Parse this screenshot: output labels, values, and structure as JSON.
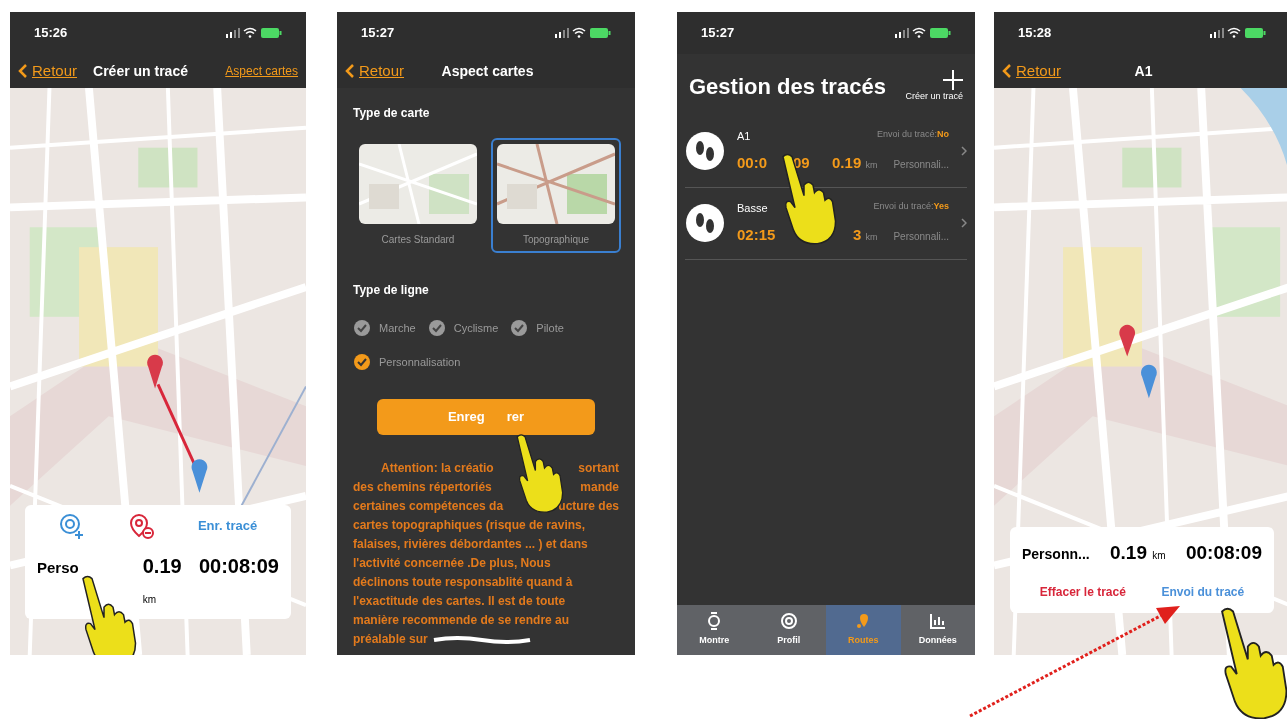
{
  "screens": [
    {
      "kind": "map_create",
      "time": "15:26",
      "nav": {
        "back": "Retour",
        "title": "Créer un tracé",
        "action": "Aspect cartes"
      },
      "panel": {
        "save": "Enr. tracé",
        "name": "Perso",
        "distance": "0.19",
        "unit": "km",
        "duration": "00:08:09"
      }
    },
    {
      "kind": "settings",
      "time": "15:27",
      "nav": {
        "back": "Retour",
        "title": "Aspect cartes"
      },
      "map_type_label": "Type de carte",
      "map_types": [
        {
          "label": "Cartes Standard",
          "selected": false
        },
        {
          "label": "Topographique",
          "selected": true
        }
      ],
      "line_type_label": "Type de ligne",
      "line_types": [
        {
          "label": "Marche",
          "checked": false
        },
        {
          "label": "Cyclisme",
          "checked": false
        },
        {
          "label": "Pilote",
          "checked": false
        },
        {
          "label": "Personnalisation",
          "checked": true
        }
      ],
      "save_button": [
        "Enreg",
        "rer"
      ],
      "warning_lines": [
        [
          "Attention: la créatio",
          "sortant"
        ],
        [
          "des chemins répertoriés",
          "mande"
        ],
        [
          "certaines compétences da",
          "ucture des"
        ],
        [
          "cartes topographiques (risque de ravins,"
        ],
        [
          "falaises, rivières débordantes ... ) et dans"
        ],
        [
          "l'activité concernée .De plus,  Nous"
        ],
        [
          "déclinons toute responsablité quand à"
        ],
        [
          "l'exactitude des cartes. Il est de toute"
        ],
        [
          "manière recommende de se rendre au"
        ],
        [
          "préalable sur"
        ]
      ]
    },
    {
      "kind": "list",
      "time": "15:27",
      "title": "Gestion des tracés",
      "create": "Créer un tracé",
      "routes": [
        {
          "name": "A1",
          "send_label": "Envoi du tracé:",
          "send_value": "No",
          "duration": [
            "00:0",
            "09"
          ],
          "distance": "0.19",
          "unit": "km",
          "type": "Personnali..."
        },
        {
          "name": "Basse",
          "send_label": "Envoi du tracé:",
          "send_value": "Yes",
          "duration": [
            "02:15"
          ],
          "distance": "3",
          "unit": "km",
          "type": "Personnali..."
        }
      ],
      "tabs": [
        {
          "label": "Montre",
          "selected": false
        },
        {
          "label": "Profil",
          "selected": false
        },
        {
          "label": "Routes",
          "selected": true
        },
        {
          "label": "Données",
          "selected": false
        }
      ]
    },
    {
      "kind": "map_detail",
      "time": "15:28",
      "nav": {
        "back": "Retour",
        "title": "A1"
      },
      "panel": {
        "name": "Personn...",
        "distance": "0.19",
        "unit": "km",
        "duration": "00:08:09",
        "delete": "Effacer le tracé",
        "send": "Envoi du tracé"
      }
    }
  ]
}
